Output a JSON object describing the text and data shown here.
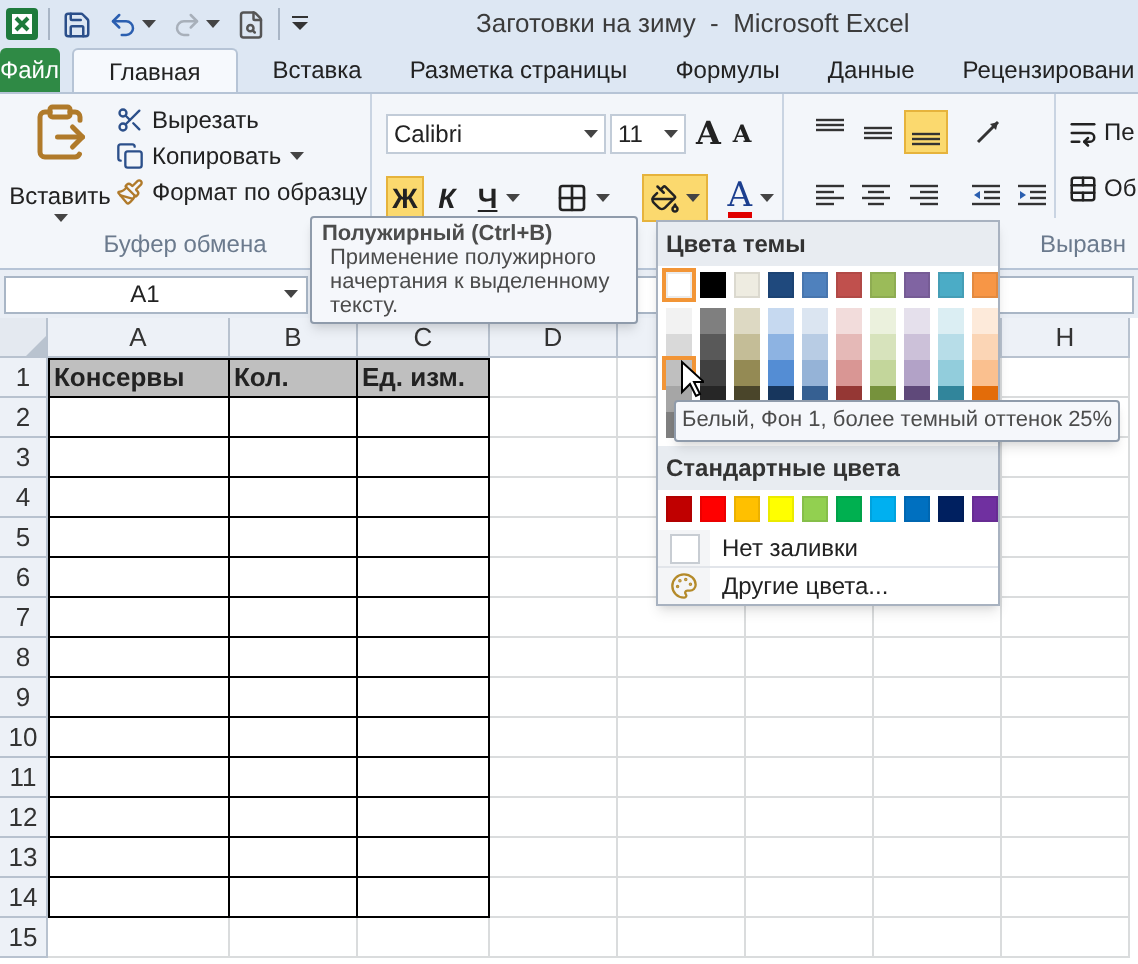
{
  "window": {
    "title": "Заготовки на зиму  -  Microsoft Excel"
  },
  "quick_access": [
    {
      "kind": "save",
      "disabled": false
    },
    {
      "kind": "undo",
      "disabled": false
    },
    {
      "kind": "redo",
      "disabled": true
    },
    {
      "kind": "preview",
      "disabled": false
    }
  ],
  "tabs": [
    {
      "kind": "file",
      "label": "Файл",
      "selected": false
    },
    {
      "kind": "tab",
      "label": "Главная",
      "selected": true
    },
    {
      "kind": "tab",
      "label": "Вставка",
      "selected": false
    },
    {
      "kind": "tab",
      "label": "Разметка страницы",
      "selected": false
    },
    {
      "kind": "tab",
      "label": "Формулы",
      "selected": false
    },
    {
      "kind": "tab",
      "label": "Данные",
      "selected": false
    },
    {
      "kind": "tab",
      "label": "Рецензировани",
      "selected": false
    }
  ],
  "clipboard": {
    "paste": "Вставить",
    "items": [
      {
        "kind": "cut",
        "label": "Вырезать"
      },
      {
        "kind": "copy",
        "label": "Копировать"
      },
      {
        "kind": "painter",
        "label": "Формат по образцу"
      }
    ],
    "label": "Буфер обмена"
  },
  "font": {
    "name": "Calibri",
    "size": "11",
    "grow": "A",
    "shrink": "A",
    "buttons": [
      {
        "kind": "bold",
        "label": "Ж",
        "active": true
      },
      {
        "kind": "italic",
        "label": "К",
        "active": false
      },
      {
        "kind": "underline",
        "label": "Ч",
        "active": false
      },
      {
        "kind": "borders",
        "active": false
      },
      {
        "kind": "fill",
        "active": true
      },
      {
        "kind": "font_color",
        "label": "A",
        "active": false
      }
    ]
  },
  "alignment": {
    "label": "Выравн",
    "buttons": [
      {
        "kind": "top",
        "active": false
      },
      {
        "kind": "middle",
        "active": false
      },
      {
        "kind": "bottom",
        "active": true
      },
      {
        "kind": "orientation",
        "active": false
      },
      {
        "kind": "left",
        "active": false
      },
      {
        "kind": "center",
        "active": false
      },
      {
        "kind": "right",
        "active": false
      },
      {
        "kind": "outdent",
        "active": false
      },
      {
        "kind": "indent",
        "active": false
      }
    ]
  },
  "wrap_group": {
    "items": [
      {
        "kind": "wrap",
        "label": "Пе"
      },
      {
        "kind": "merge",
        "label": "Об"
      }
    ]
  },
  "name_box": {
    "value": "A1"
  },
  "sheet": {
    "columns": [
      {
        "label": "A"
      },
      {
        "label": "B"
      },
      {
        "label": "C"
      },
      {
        "label": "D"
      },
      {},
      {},
      {},
      {
        "label": "H"
      }
    ],
    "rows": [
      {
        "number": "1",
        "bordered": true,
        "header": true,
        "cells": [
          "Консервы",
          "Кол.",
          "Ед. изм."
        ]
      },
      {
        "number": "2",
        "bordered": true
      },
      {
        "number": "3",
        "bordered": true
      },
      {
        "number": "4",
        "bordered": true
      },
      {
        "number": "5",
        "bordered": true
      },
      {
        "number": "6",
        "bordered": true
      },
      {
        "number": "7",
        "bordered": true
      },
      {
        "number": "8",
        "bordered": true
      },
      {
        "number": "9",
        "bordered": true
      },
      {
        "number": "10",
        "bordered": true
      },
      {
        "number": "11",
        "bordered": true
      },
      {
        "number": "12",
        "bordered": true
      },
      {
        "number": "13",
        "bordered": true
      },
      {
        "number": "14",
        "bordered": true
      },
      {
        "number": "15",
        "bordered": false
      }
    ]
  },
  "bold_tooltip": {
    "title": "Полужирный (Ctrl+B)",
    "text": "Применение полужирного начертания к выделенному тексту."
  },
  "fill_menu": {
    "theme_title": "Цвета темы",
    "theme_colors": [
      {
        "color": "#ffffff",
        "selected": true
      },
      {
        "color": "#000000",
        "selected": false
      },
      {
        "color": "#eeece1",
        "selected": false
      },
      {
        "color": "#1f497d",
        "selected": false
      },
      {
        "color": "#4f81bd",
        "selected": false
      },
      {
        "color": "#c0504d",
        "selected": false
      },
      {
        "color": "#9bbb59",
        "selected": false
      },
      {
        "color": "#8064a2",
        "selected": false
      },
      {
        "color": "#4bacc6",
        "selected": false
      },
      {
        "color": "#f79646",
        "selected": false
      }
    ],
    "shades": [
      [
        {
          "color": "#f2f2f2",
          "selected": false
        },
        {
          "color": "#7f7f7f",
          "selected": false
        },
        {
          "color": "#ddd9c3",
          "selected": false
        },
        {
          "color": "#c6d9f0",
          "selected": false
        },
        {
          "color": "#dbe5f1",
          "selected": false
        },
        {
          "color": "#f2dcdb",
          "selected": false
        },
        {
          "color": "#ebf1dd",
          "selected": false
        },
        {
          "color": "#e5e0ec",
          "selected": false
        },
        {
          "color": "#dbeef3",
          "selected": false
        },
        {
          "color": "#fdeada",
          "selected": false
        }
      ],
      [
        {
          "color": "#d9d9d9",
          "selected": false
        },
        {
          "color": "#595959",
          "selected": false
        },
        {
          "color": "#c4bd97",
          "selected": false
        },
        {
          "color": "#8db3e2",
          "selected": false
        },
        {
          "color": "#b8cce4",
          "selected": false
        },
        {
          "color": "#e5b9b7",
          "selected": false
        },
        {
          "color": "#d7e3bc",
          "selected": false
        },
        {
          "color": "#ccc1d9",
          "selected": false
        },
        {
          "color": "#b7dde8",
          "selected": false
        },
        {
          "color": "#fbd5b5",
          "selected": false
        }
      ],
      [
        {
          "color": "#bfbfbf",
          "selected": true
        },
        {
          "color": "#404040",
          "selected": false
        },
        {
          "color": "#948a54",
          "selected": false
        },
        {
          "color": "#548dd4",
          "selected": false
        },
        {
          "color": "#95b3d7",
          "selected": false
        },
        {
          "color": "#d99694",
          "selected": false
        },
        {
          "color": "#c3d69b",
          "selected": false
        },
        {
          "color": "#b2a2c7",
          "selected": false
        },
        {
          "color": "#92cddc",
          "selected": false
        },
        {
          "color": "#fac08f",
          "selected": false
        }
      ],
      [
        {
          "color": "#a6a6a6",
          "selected": false
        },
        {
          "color": "#262626",
          "selected": false
        },
        {
          "color": "#4a452a",
          "selected": false
        },
        {
          "color": "#17365d",
          "selected": false
        },
        {
          "color": "#366092",
          "selected": false
        },
        {
          "color": "#953734",
          "selected": false
        },
        {
          "color": "#76923c",
          "selected": false
        },
        {
          "color": "#5f497a",
          "selected": false
        },
        {
          "color": "#31859b",
          "selected": false
        },
        {
          "color": "#e36c09",
          "selected": false
        }
      ],
      [
        {
          "color": "#808080",
          "selected": false
        }
      ]
    ],
    "standard_title": "Стандартные цвета",
    "standard_colors": [
      {
        "color": "#c00000",
        "selected": false
      },
      {
        "color": "#ff0000",
        "selected": false
      },
      {
        "color": "#ffc000",
        "selected": false
      },
      {
        "color": "#ffff00",
        "selected": false
      },
      {
        "color": "#92d050",
        "selected": false
      },
      {
        "color": "#00b050",
        "selected": false
      },
      {
        "color": "#00b0f0",
        "selected": false
      },
      {
        "color": "#0070c0",
        "selected": false
      },
      {
        "color": "#002060",
        "selected": false
      },
      {
        "color": "#7030a0",
        "selected": false
      }
    ],
    "no_fill": "Нет заливки",
    "more_colors": "Другие цвета..."
  },
  "color_tooltip": "Белый, Фон 1, более темный оттенок 25%"
}
